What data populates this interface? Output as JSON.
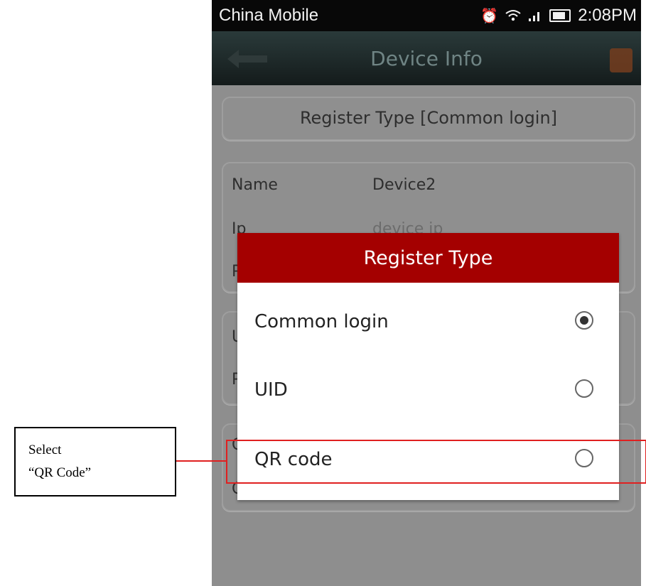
{
  "status_bar": {
    "carrier": "China Mobile",
    "time": "2:08PM",
    "icons": [
      "alarm-icon",
      "wifi-icon",
      "signal-icon",
      "battery-icon"
    ]
  },
  "title_bar": {
    "title": "Device Info",
    "back_icon": "back-arrow-icon",
    "share_icon": "share-icon"
  },
  "register_card": {
    "text": "Register Type   [Common login]"
  },
  "info_card": {
    "rows": [
      {
        "label": "Name",
        "value": "Device2"
      },
      {
        "label": "Ip",
        "placeholder": "device ip"
      },
      {
        "label": "P"
      }
    ]
  },
  "user_card": {
    "rows": [
      {
        "label": "U"
      },
      {
        "label": "P"
      }
    ]
  },
  "cloud_card": {
    "rows": [
      {
        "label": "C"
      },
      {
        "label": "C"
      }
    ]
  },
  "dialog": {
    "title": "Register Type",
    "options": [
      {
        "label": "Common login",
        "selected": true
      },
      {
        "label": "UID",
        "selected": false
      },
      {
        "label": "QR code",
        "selected": false
      }
    ]
  },
  "annotation": {
    "line1": "Select",
    "line2": "“QR Code”",
    "color": "#e02020"
  },
  "colors": {
    "dialog_header": "#a40000",
    "overlay": "#8e8e8e"
  }
}
